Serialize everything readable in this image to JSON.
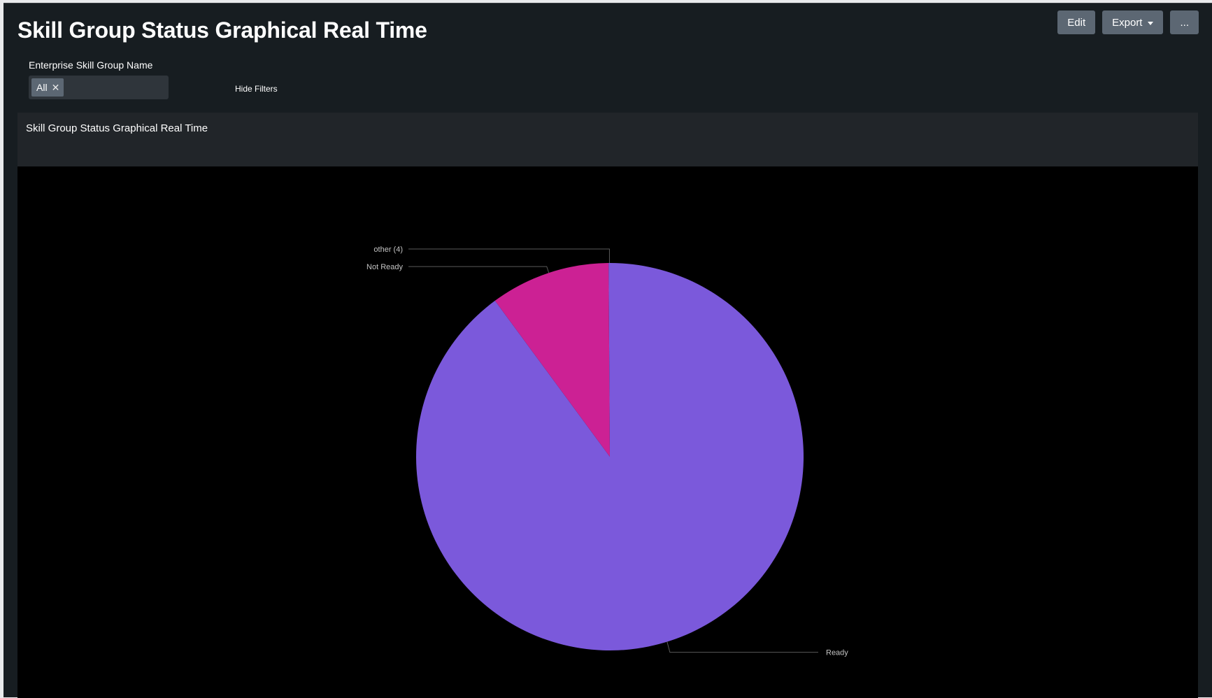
{
  "header": {
    "title": "Skill Group Status Graphical Real Time",
    "edit_label": "Edit",
    "export_label": "Export",
    "more_label": "..."
  },
  "filters": {
    "label": "Enterprise Skill Group Name",
    "selected": "All",
    "hide_filters_label": "Hide Filters"
  },
  "panel": {
    "title": "Skill Group Status Graphical Real Time"
  },
  "colors": {
    "ready": "#7b59db",
    "not_ready": "#cc2194",
    "other": "#7b59db",
    "leader_line": "#5a5a5a"
  },
  "chart_data": {
    "type": "pie",
    "categories": [
      "Ready",
      "Not Ready",
      "other (4)"
    ],
    "values": [
      89.9,
      10.0,
      0.1
    ],
    "labels": [
      "Ready",
      "Not Ready",
      "other (4)"
    ]
  }
}
